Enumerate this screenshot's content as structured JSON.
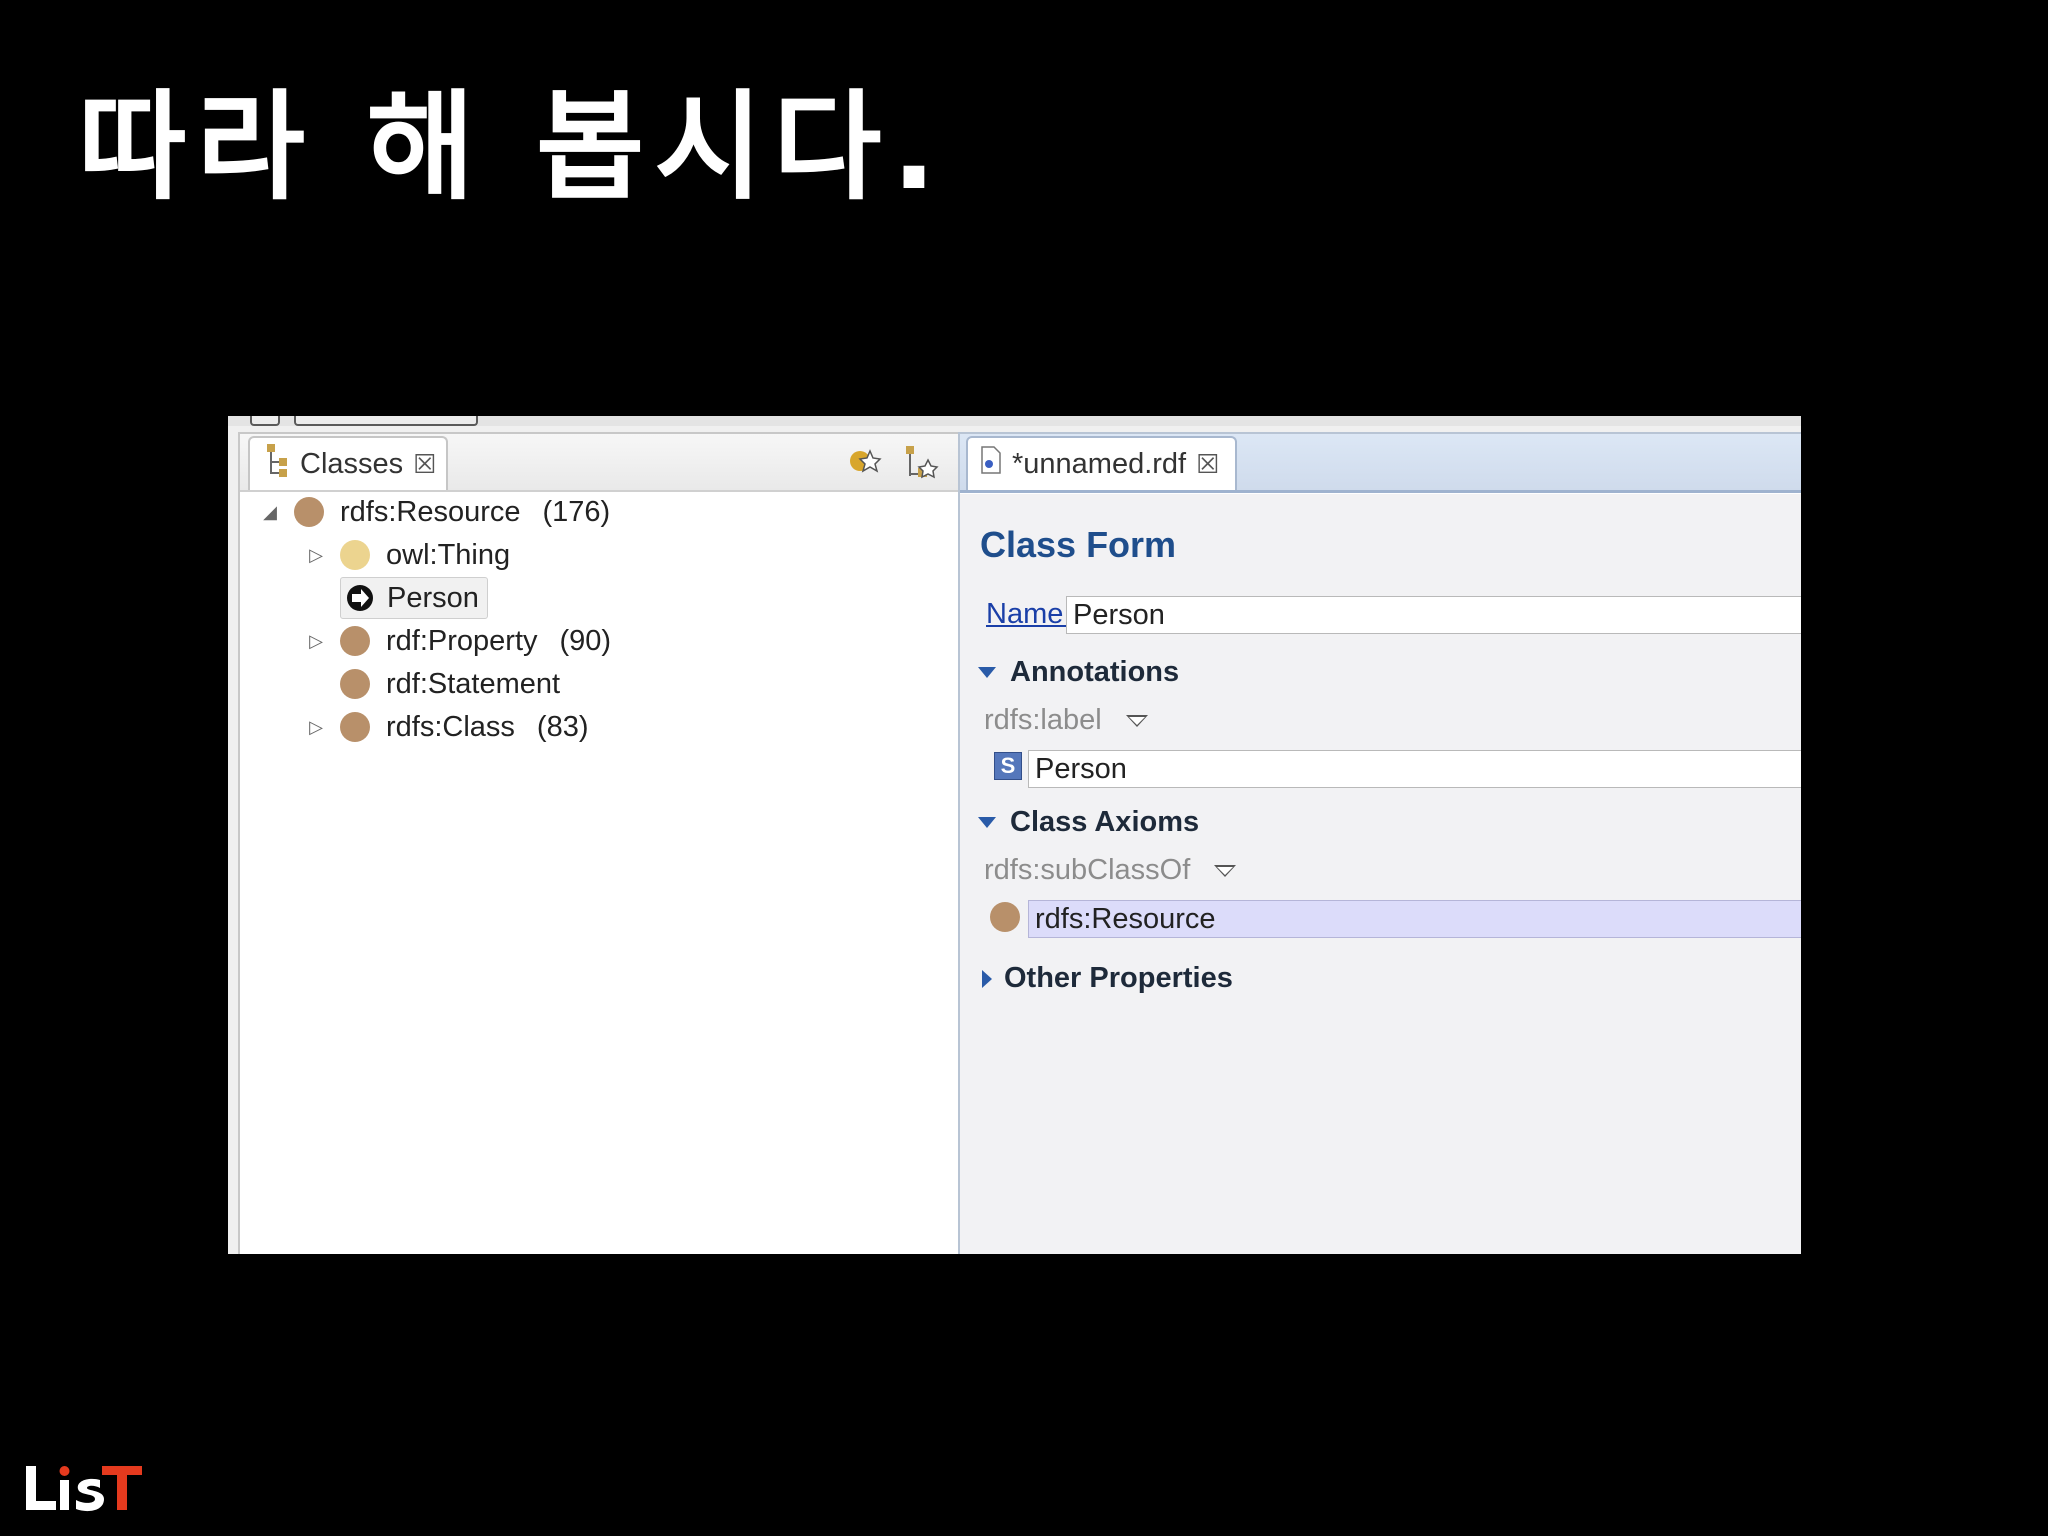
{
  "slide": {
    "title": "따라 해 봅시다.",
    "logo_text": "LiST"
  },
  "left_view": {
    "tab_label": "Classes",
    "tab_icon": "class-hierarchy-icon",
    "toolbar_icons": [
      "add-subclass-icon",
      "add-sibling-class-icon",
      "delete-class-icon",
      "view-menu-icon",
      "minimize-icon",
      "maximize-icon"
    ],
    "tree": [
      {
        "label": "rdfs:Resource",
        "count": "(176)",
        "expanded": true,
        "level": 0,
        "icon": "class-dot-brown"
      },
      {
        "label": "owl:Thing",
        "count": "",
        "expanded": false,
        "level": 1,
        "icon": "class-dot-light"
      },
      {
        "label": "Person",
        "count": "",
        "level": 1,
        "selected": true,
        "icon": "new-class-icon"
      },
      {
        "label": "rdf:Property",
        "count": "(90)",
        "expanded": false,
        "level": 1,
        "icon": "class-dot-brown"
      },
      {
        "label": "rdf:Statement",
        "count": "",
        "level": 1,
        "icon": "class-dot-brown"
      },
      {
        "label": "rdfs:Class",
        "count": "(83)",
        "expanded": false,
        "level": 1,
        "icon": "class-dot-brown"
      }
    ]
  },
  "editor": {
    "tab_label": "*unnamed.rdf",
    "tab_icon": "rdf-file-icon",
    "form_title": "Class Form",
    "name_label": "Name:",
    "name_value": "Person",
    "annotations": {
      "header": "Annotations",
      "property": "rdfs:label",
      "value_type_badge": "S",
      "value": "Person"
    },
    "class_axioms": {
      "header": "Class Axioms",
      "property": "rdfs:subClassOf",
      "value": "rdfs:Resource"
    },
    "other_properties": {
      "header": "Other Properties",
      "expanded": false
    }
  },
  "colors": {
    "form_title": "#1f4e8c",
    "class_dot": "#b8906a",
    "thing_dot": "#ecd48f",
    "selected_value_bg": "#dcdcfa"
  }
}
